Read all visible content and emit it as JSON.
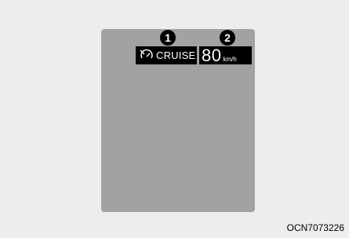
{
  "callouts": {
    "first": "1",
    "second": "2"
  },
  "cruise_indicator": {
    "label": "CRUISE",
    "icon": "cruise-control-icon"
  },
  "speed_display": {
    "value": "80",
    "unit": "km/h"
  },
  "figure_code": "OCN7073226",
  "colors": {
    "background": "#ededed",
    "panel": "#a2a2a2",
    "indicator_bg": "#000000",
    "indicator_text": "#ffffff"
  }
}
